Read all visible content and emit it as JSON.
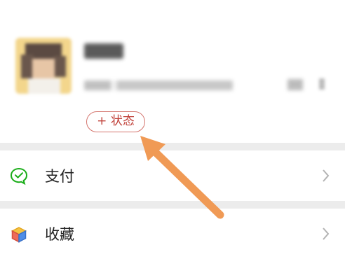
{
  "profile": {
    "status_button_label": "+ 状态"
  },
  "menu": {
    "items": [
      {
        "label": "支付",
        "icon": "payment-icon",
        "icon_color": "#1aad19"
      },
      {
        "label": "收藏",
        "icon": "favorites-cube-icon",
        "icon_color": "#e6a23c"
      }
    ]
  },
  "colors": {
    "status_accent": "#d4756e",
    "arrow": "#f09a55"
  }
}
